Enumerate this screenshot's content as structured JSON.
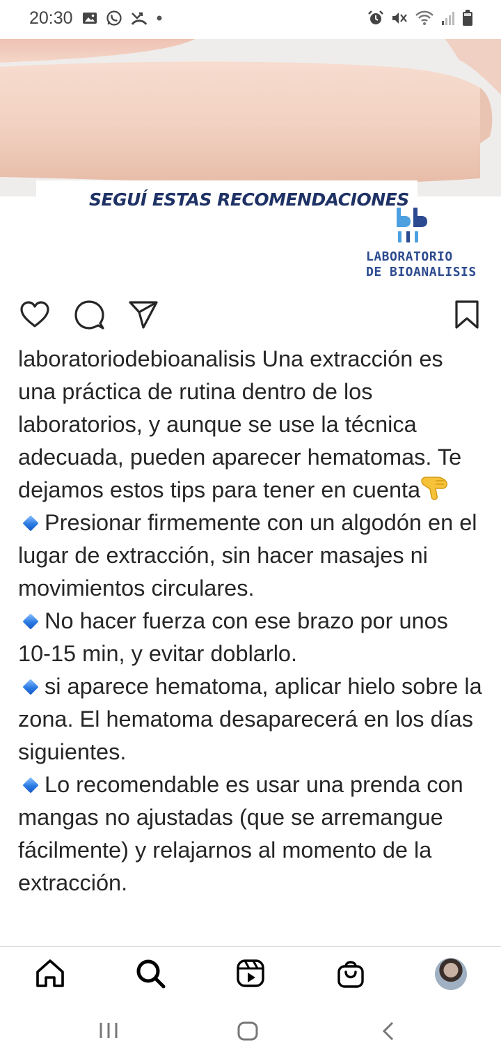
{
  "status_bar": {
    "time": "20:30",
    "left_icons": [
      "image-icon",
      "whatsapp-icon",
      "missed-call-icon",
      "dot-icon"
    ],
    "right_icons": [
      "alarm-icon",
      "mute-icon",
      "wifi-icon",
      "signal-icon",
      "battery-icon"
    ]
  },
  "post_image": {
    "banner_text": "SEGUÍ ESTAS RECOMENDACIONES",
    "logo_line1": "LABORATORIO",
    "logo_line2": "DE BIOANALISIS",
    "brand_color": "#1f3266"
  },
  "actions": {
    "icons": [
      "heart-icon",
      "comment-icon",
      "share-icon",
      "bookmark-icon"
    ]
  },
  "caption": {
    "username": "laboratoriodebioanalisis",
    "intro": " Una extracción es una práctica de rutina dentro de los laboratorios, y aunque se use la técnica adecuada, pueden aparecer hematomas. Te dejamos estos tips para tener en cuenta",
    "intro_emoji": "backhand-index-pointing-down",
    "tips": [
      "Presionar firmemente con un algodón en el lugar de extracción, sin hacer masajes ni movimientos circulares.",
      "No hacer fuerza con ese brazo por unos 10-15 min, y evitar doblarlo.",
      "si aparece hematoma, aplicar hielo sobre la zona. El hematoma desaparecerá en los días siguientes.",
      "Lo recomendable es usar una prenda con mangas no ajustadas (que se arremangue fácilmente) y relajarnos al momento de la extracción."
    ],
    "bullet_icon": "blue-diamond-icon"
  },
  "bottom_nav": {
    "items": [
      "home-icon",
      "search-icon",
      "reels-icon",
      "shop-icon",
      "profile-avatar"
    ]
  },
  "system_nav": {
    "items": [
      "recents-icon",
      "home-button-icon",
      "back-icon"
    ]
  }
}
